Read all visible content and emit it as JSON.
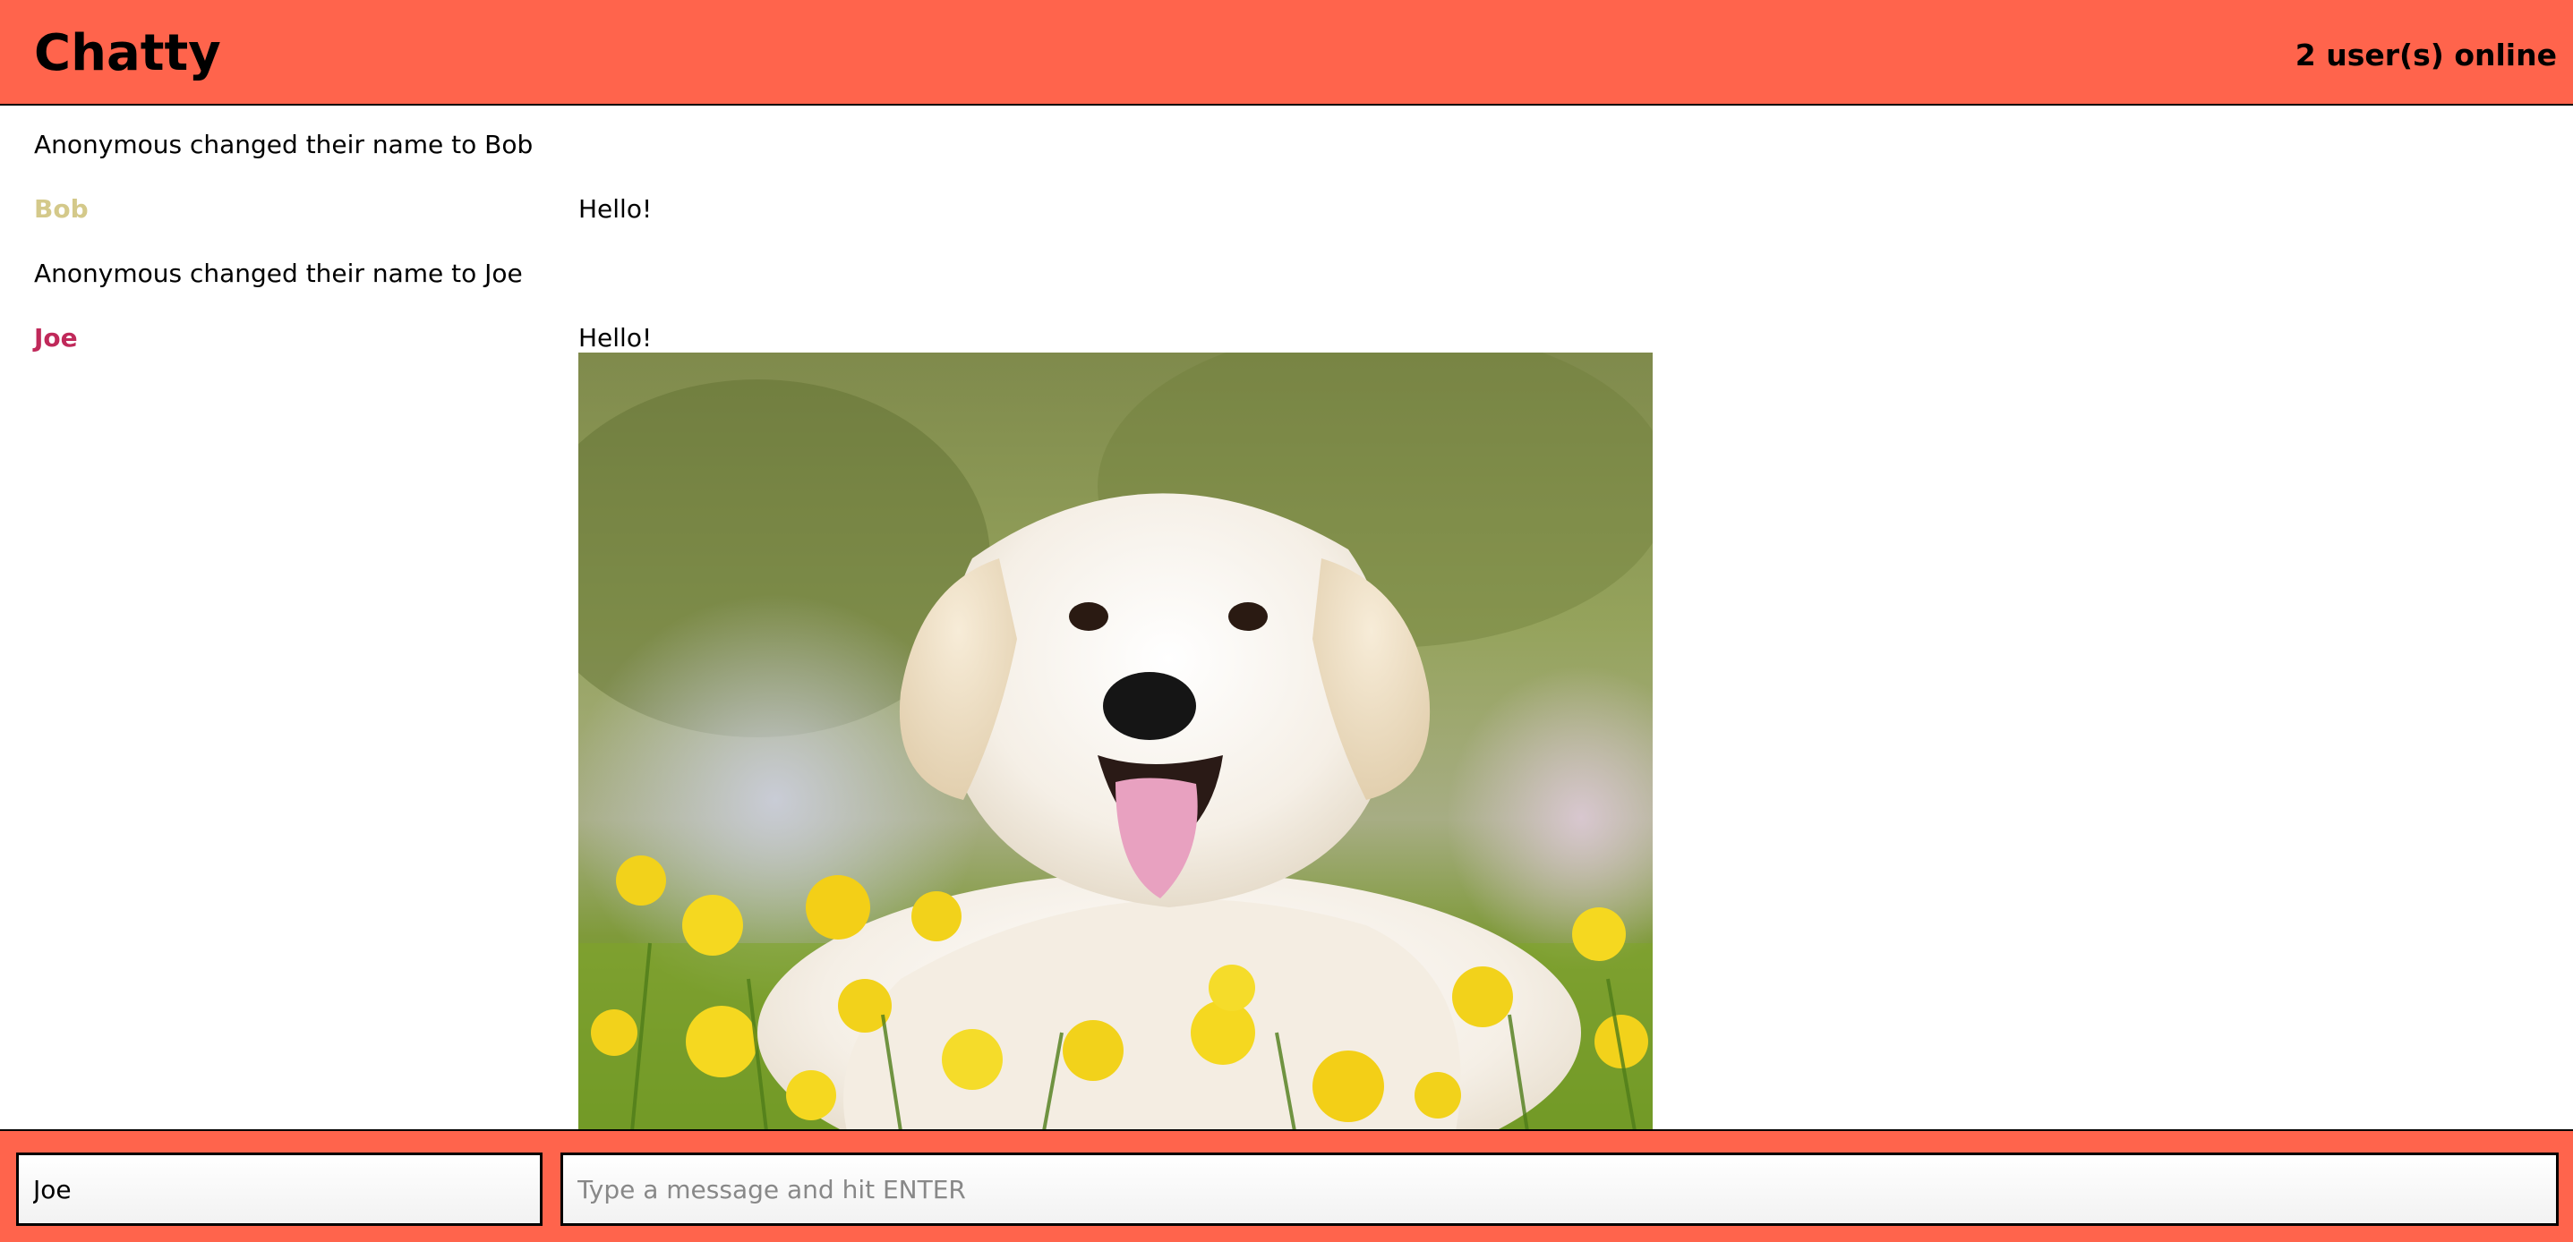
{
  "header": {
    "brand": "Chatty",
    "online_count": "2 user(s) online"
  },
  "messages": [
    {
      "type": "system",
      "text": "Anonymous changed their name to Bob"
    },
    {
      "type": "chat",
      "user": "Bob",
      "content": "Hello!",
      "user_color": "#d4c98a"
    },
    {
      "type": "system",
      "text": "Anonymous changed their name to Joe"
    },
    {
      "type": "chat",
      "user": "Joe",
      "content": "Hello!",
      "user_color": "#c0295a",
      "attachment": "dog-photo"
    }
  ],
  "composer": {
    "username_value": "Joe",
    "message_placeholder": "Type a message and hit ENTER"
  },
  "colors": {
    "accent": "#ff644c",
    "border": "#000000"
  }
}
